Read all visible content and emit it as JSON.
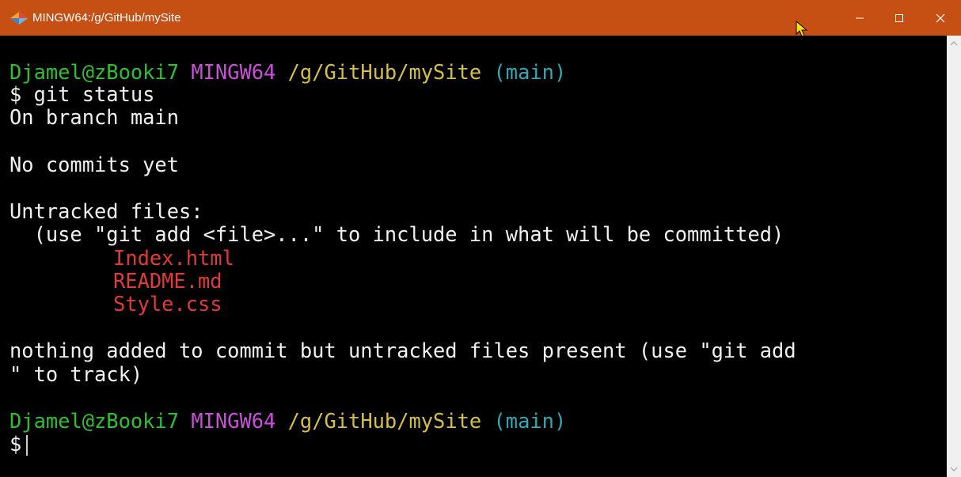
{
  "window": {
    "title": "MINGW64:/g/GitHub/mySite",
    "titlebar_color": "#C65014",
    "icons": {
      "app": "git-diamond-icon",
      "minimize": "minimize-icon",
      "maximize": "maximize-icon",
      "close": "close-icon",
      "pointer": "mouse-pointer-icon"
    }
  },
  "terminal": {
    "prompt1": {
      "user_host": "Djamel@zBooki7",
      "env": "MINGW64",
      "path": "/g/GitHub/mySite",
      "branch": "(main)",
      "symbol": "$",
      "command": "git status"
    },
    "output": {
      "on_branch": "On branch main",
      "no_commits": "No commits yet",
      "untracked_header": "Untracked files:",
      "hint": "  (use \"git add <file>...\" to include in what will be committed)",
      "files": [
        "Index.html",
        "README.md",
        "Style.css"
      ],
      "summary_line1": "nothing added to commit but untracked files present (use \"git add",
      "summary_line2": "\" to track)"
    },
    "prompt2": {
      "user_host": "Djamel@zBooki7",
      "env": "MINGW64",
      "path": "/g/GitHub/mySite",
      "branch": "(main)",
      "symbol": "$"
    },
    "colors": {
      "user_host": "#2FC02F",
      "env": "#C94FD8",
      "path": "#D6C043",
      "branch": "#2EA9B5",
      "untracked_file": "#E03A3A",
      "text": "#F0F0F0",
      "background": "#000000"
    }
  },
  "scrollbar": {
    "up_icon": "scroll-up-arrow-icon",
    "down_icon": "scroll-down-arrow-icon"
  }
}
